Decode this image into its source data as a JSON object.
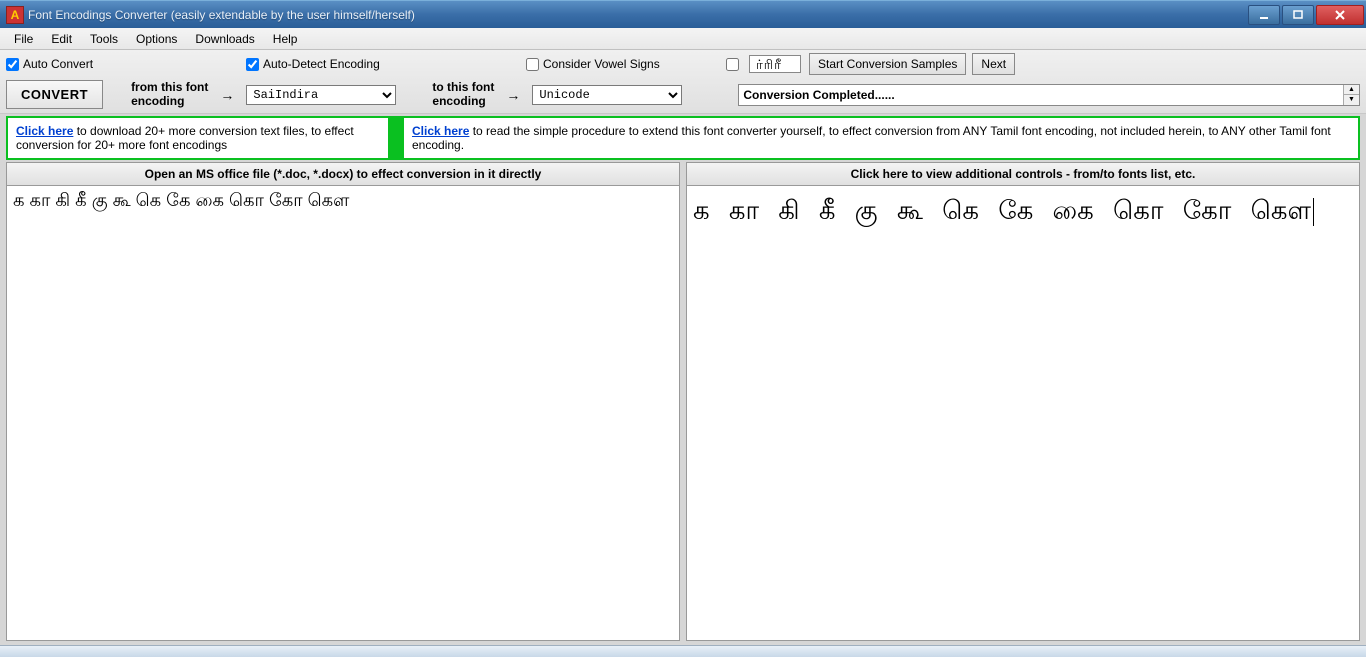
{
  "window": {
    "title": "Font Encodings Converter (easily extendable by the user himself/herself)"
  },
  "menu": {
    "items": [
      "File",
      "Edit",
      "Tools",
      "Options",
      "Downloads",
      "Help"
    ]
  },
  "toolbar": {
    "auto_convert_label": "Auto Convert",
    "auto_convert_checked": true,
    "auto_detect_label": "Auto-Detect Encoding",
    "auto_detect_checked": true,
    "consider_vowel_label": "Consider Vowel Signs",
    "consider_vowel_checked": false,
    "sample_checkbox_checked": false,
    "sample_text": "ர்ரிரீ",
    "start_samples_label": "Start Conversion Samples",
    "next_label": "Next",
    "convert_label": "CONVERT",
    "from_label_1": "from this font",
    "from_label_2": "encoding",
    "from_value": "SaiIndira",
    "to_label_1": "to this font",
    "to_label_2": "encoding",
    "to_value": "Unicode",
    "status": "Conversion Completed......"
  },
  "info": {
    "link": "Click here",
    "left_text": " to download 20+ more conversion text files, to effect conversion for 20+ more font encodings",
    "right_text": " to read the simple procedure to extend this font converter yourself, to effect conversion from ANY Tamil font encoding, not included herein, to ANY other Tamil font encoding."
  },
  "panels": {
    "left_header": "Open an MS office file (*.doc, *.docx) to effect conversion in it directly",
    "right_header": "Click here to view additional controls - from/to fonts list, etc.",
    "left_text": "க கா கி கீ கு கூ கெ கே கை  கொ கோ கௌ",
    "right_text": "க கா கி கீ கு கூ கெ கே கை  கொ கோ கௌ"
  }
}
